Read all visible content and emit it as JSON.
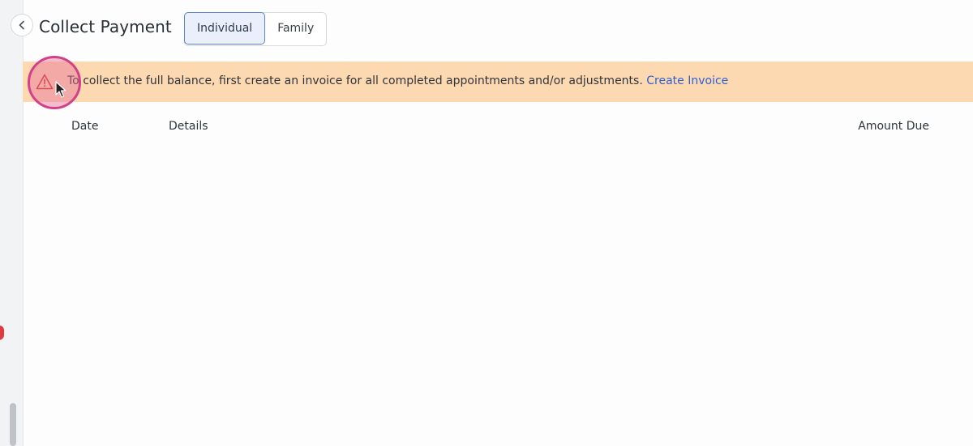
{
  "header": {
    "title": "Collect Payment",
    "tabs": [
      {
        "label": "Individual",
        "selected": true
      },
      {
        "label": "Family",
        "selected": false
      }
    ]
  },
  "alert": {
    "text": "To collect the full balance, first create an invoice for all completed appointments and/or adjustments.",
    "link_label": "Create Invoice",
    "icon": "warning-triangle-icon",
    "background": "#fdd9b2",
    "link_color": "#2f5fd0"
  },
  "table": {
    "columns": [
      "Date",
      "Details",
      "Amount Due"
    ],
    "rows": []
  },
  "icons": {
    "back": "chevron-left-icon"
  },
  "colors": {
    "accent": "#5b82d6",
    "notification_dot": "#e0393e"
  }
}
